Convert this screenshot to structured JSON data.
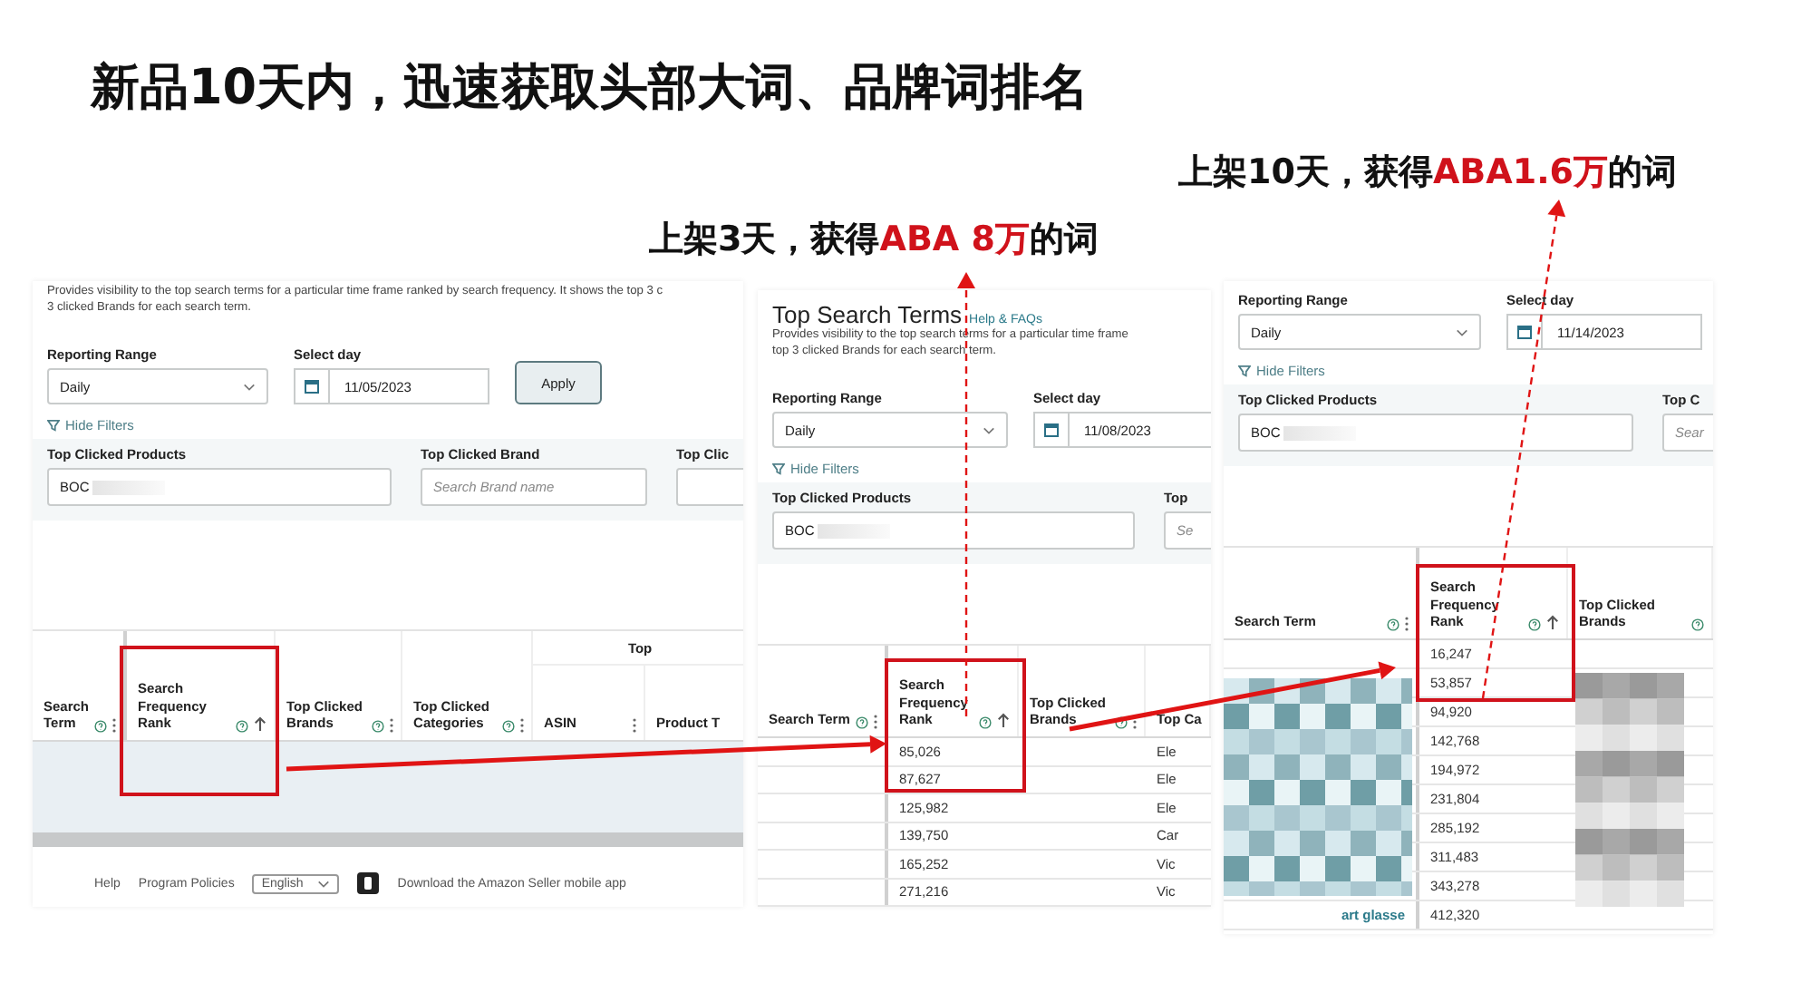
{
  "title": "新品10天内，迅速获取头部大词、品牌词排名",
  "callouts": [
    {
      "prefix": "上架10天，获得",
      "highlight": "ABA1.6万",
      "suffix": "的词"
    },
    {
      "prefix": "上架3天，获得",
      "highlight": "ABA 8万",
      "suffix": "的词"
    }
  ],
  "panels": [
    {
      "description": [
        "Provides visibility to the top search terms for a particular time frame ranked by search frequency. It shows the top 3 c",
        "3 clicked Brands for each search term."
      ],
      "reporting_range": {
        "label": "Reporting Range",
        "value": "Daily"
      },
      "select_day": {
        "label": "Select day",
        "value": "11/05/2023"
      },
      "apply_button": "Apply",
      "hide_filters": "Hide Filters",
      "filters": [
        {
          "label": "Top Clicked Products",
          "value": "BOC"
        },
        {
          "label": "Top Clicked Brand",
          "placeholder": "Search Brand name"
        },
        {
          "label": "Top Clic"
        }
      ],
      "table": {
        "group_header": "Top",
        "columns": [
          {
            "label": "Search Term",
            "help": true,
            "sorted": false
          },
          {
            "label": "Search Frequency Rank",
            "help": true,
            "sorted": true
          },
          {
            "label": "Top Clicked Brands",
            "help": true,
            "sorted": false
          },
          {
            "label": "Top Clicked Categories",
            "help": true,
            "sorted": false
          },
          {
            "label": "ASIN",
            "help": false,
            "sorted": false
          },
          {
            "label": "Product T",
            "help": false,
            "sorted": false
          }
        ]
      },
      "footer": {
        "links": [
          "Help",
          "Program Policies"
        ],
        "language": "English",
        "app_text": "Download the Amazon Seller mobile app"
      }
    },
    {
      "title": "Top Search Terms",
      "help_link": "Help & FAQs",
      "description": [
        "Provides visibility to the top search terms for a particular time frame",
        "top 3 clicked Brands for each search term."
      ],
      "reporting_range": {
        "label": "Reporting Range",
        "value": "Daily"
      },
      "select_day": {
        "label": "Select day",
        "value": "11/08/2023"
      },
      "hide_filters": "Hide Filters",
      "filters": [
        {
          "label": "Top Clicked Products",
          "value": "BOC"
        },
        {
          "label": "Top",
          "placeholder": "Se"
        }
      ],
      "table": {
        "columns": [
          {
            "label": "Search Term",
            "help": true,
            "sorted": false
          },
          {
            "label": "Search Frequency Rank",
            "help": true,
            "sorted": true
          },
          {
            "label": "Top Clicked Brands",
            "help": true,
            "sorted": false
          },
          {
            "label": "Top Ca",
            "help": false,
            "sorted": false
          }
        ],
        "rows": [
          {
            "rank": "85,026",
            "category": "Ele"
          },
          {
            "rank": "87,627",
            "category": "Ele"
          },
          {
            "rank": "125,982",
            "category": "Ele"
          },
          {
            "rank": "139,750",
            "category": "Car"
          },
          {
            "rank": "165,252",
            "category": "Vic"
          },
          {
            "rank": "271,216",
            "category": "Vic"
          }
        ]
      }
    },
    {
      "reporting_range": {
        "label": "Reporting Range",
        "value": "Daily"
      },
      "select_day": {
        "label": "Select day",
        "value": "11/14/2023"
      },
      "hide_filters": "Hide Filters",
      "filters": [
        {
          "label": "Top Clicked Products",
          "value": "BOC"
        },
        {
          "label": "Top C",
          "placeholder": "Sear"
        }
      ],
      "table": {
        "columns": [
          {
            "label": "Search Term",
            "help": true,
            "sorted": false
          },
          {
            "label": "Search Frequency Rank",
            "help": true,
            "sorted": true
          },
          {
            "label": "Top Clicked Brands",
            "help": true,
            "sorted": false
          }
        ],
        "rows": [
          {
            "rank": "16,247"
          },
          {
            "rank": "53,857"
          },
          {
            "rank": "94,920"
          },
          {
            "rank": "142,768"
          },
          {
            "rank": "194,972"
          },
          {
            "rank": "231,804"
          },
          {
            "rank": "285,192"
          },
          {
            "rank": "311,483"
          },
          {
            "rank": "343,278"
          },
          {
            "term": "art glasse",
            "rank": "412,320"
          }
        ]
      }
    }
  ]
}
